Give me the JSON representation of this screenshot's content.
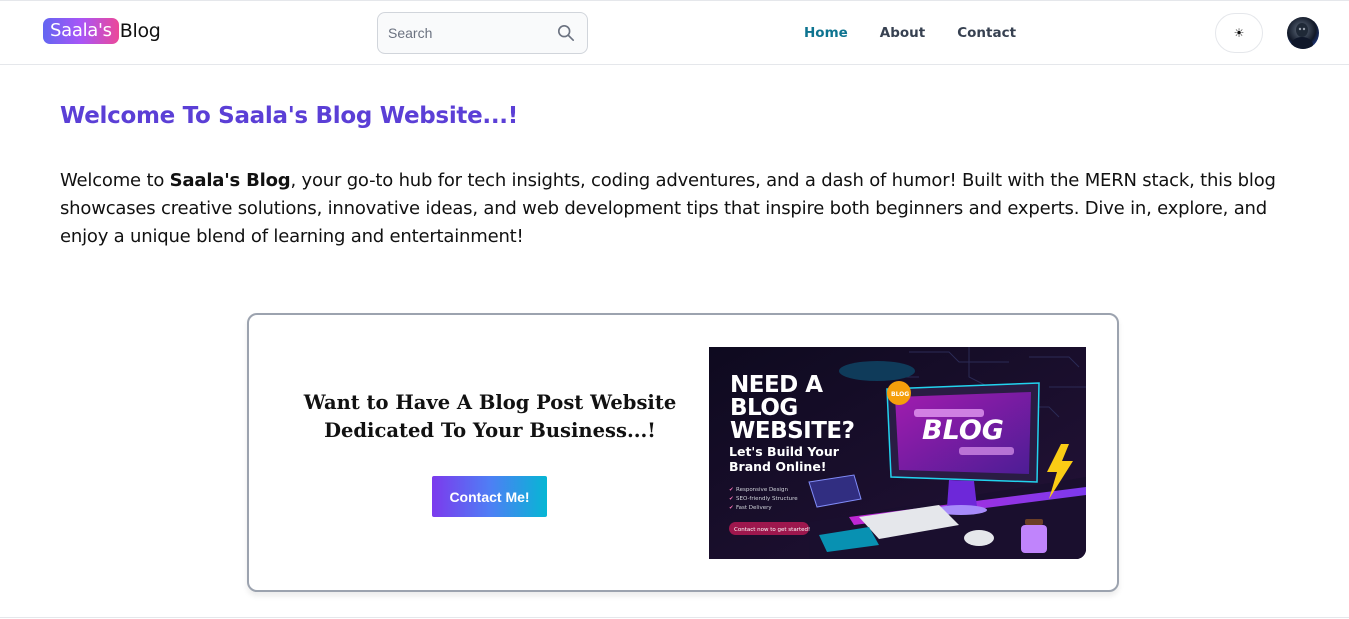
{
  "header": {
    "logo_badge": "Saala's",
    "logo_text": "Blog",
    "search_placeholder": "Search",
    "nav": [
      {
        "label": "Home",
        "active": true
      },
      {
        "label": "About",
        "active": false
      },
      {
        "label": "Contact",
        "active": false
      }
    ],
    "theme_toggle_icon": "sun-icon",
    "theme_toggle_glyph": "☀"
  },
  "hero": {
    "title": "Welcome To Saala's Blog Website...!",
    "body_prefix": "Welcome to ",
    "body_bold": "Saala's Blog",
    "body_suffix": ", your go-to hub for tech insights, coding adventures, and a dash of humor! Built with the MERN stack, this blog showcases creative solutions, innovative ideas, and web development tips that inspire both beginners and experts. Dive in, explore, and enjoy a unique blend of learning and entertainment!"
  },
  "cta": {
    "heading_line1": "Want to Have A Blog Post Website",
    "heading_line2": "Dedicated To Your Business...!",
    "button_label": "Contact Me!",
    "image": {
      "headline": [
        "NEED A",
        "BLOG",
        "WEBSITE?"
      ],
      "subhead": [
        "Let's Build Your",
        "Brand Online!"
      ],
      "features": [
        "Responsive Design",
        "SEO-friendly Structure",
        "Fast Delivery"
      ],
      "pill": "Contact now to get started!",
      "screen_word": "BLOG",
      "badge": "BLOG"
    }
  },
  "colors": {
    "accent_title": "#5b3fd6",
    "nav_active": "#0e7490",
    "logo_gradient_start": "#6366f1",
    "logo_gradient_end": "#ec4899"
  }
}
